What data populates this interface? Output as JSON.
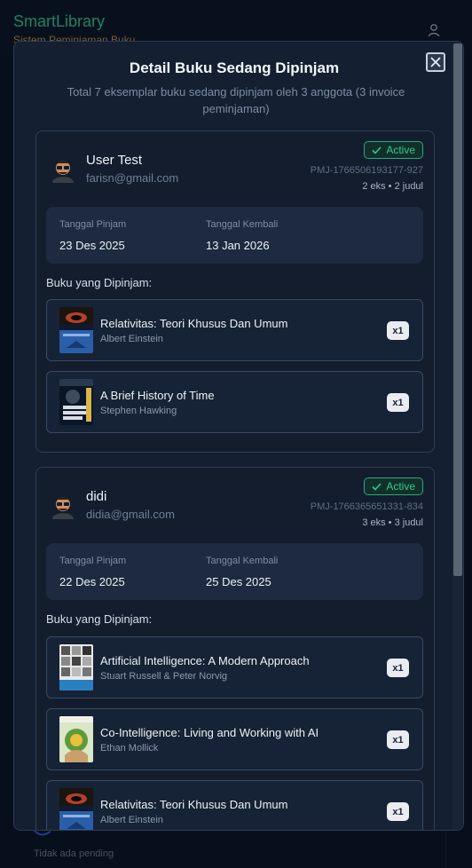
{
  "app": {
    "brand": "SmartLibrary",
    "subtitle": "Sistem Peminjaman Buku",
    "pending_text": "Tidak ada pending"
  },
  "modal": {
    "title": "Detail Buku Sedang Dipinjam",
    "description": "Total 7 eksemplar buku sedang dipinjam oleh 3 anggota (3 invoice peminjaman)",
    "close_icon": "close-icon"
  },
  "labels": {
    "borrow_date": "Tanggal Pinjam",
    "return_date": "Tanggal Kembali",
    "borrowed_books": "Buku yang Dipinjam:"
  },
  "loans": [
    {
      "name": "User Test",
      "email": "farisn@gmail.com",
      "status": "Active",
      "invoice": "PMJ-1766506193177-927",
      "counts": "2 eks • 2 judul",
      "borrow_date": "23 Des 2025",
      "return_date": "13 Jan 2026",
      "books": [
        {
          "title": "Relativitas: Teori Khusus Dan Umum",
          "author": "Albert Einstein",
          "qty": "x1"
        },
        {
          "title": "A Brief History of Time",
          "author": "Stephen Hawking",
          "qty": "x1"
        }
      ]
    },
    {
      "name": "didi",
      "email": "didia@gmail.com",
      "status": "Active",
      "invoice": "PMJ-1766365651331-834",
      "counts": "3 eks • 3 judul",
      "borrow_date": "22 Des 2025",
      "return_date": "25 Des 2025",
      "books": [
        {
          "title": "Artificial Intelligence: A Modern Approach",
          "author": "Stuart Russell & Peter Norvig",
          "qty": "x1"
        },
        {
          "title": "Co-Intelligence: Living and Working with AI",
          "author": "Ethan Mollick",
          "qty": "x1"
        },
        {
          "title": "Relativitas: Teori Khusus Dan Umum",
          "author": "Albert Einstein",
          "qty": "x1"
        }
      ]
    }
  ],
  "colors": {
    "accent_green": "#37c991",
    "brand_green": "#35c28e",
    "panel": "#141f31"
  }
}
